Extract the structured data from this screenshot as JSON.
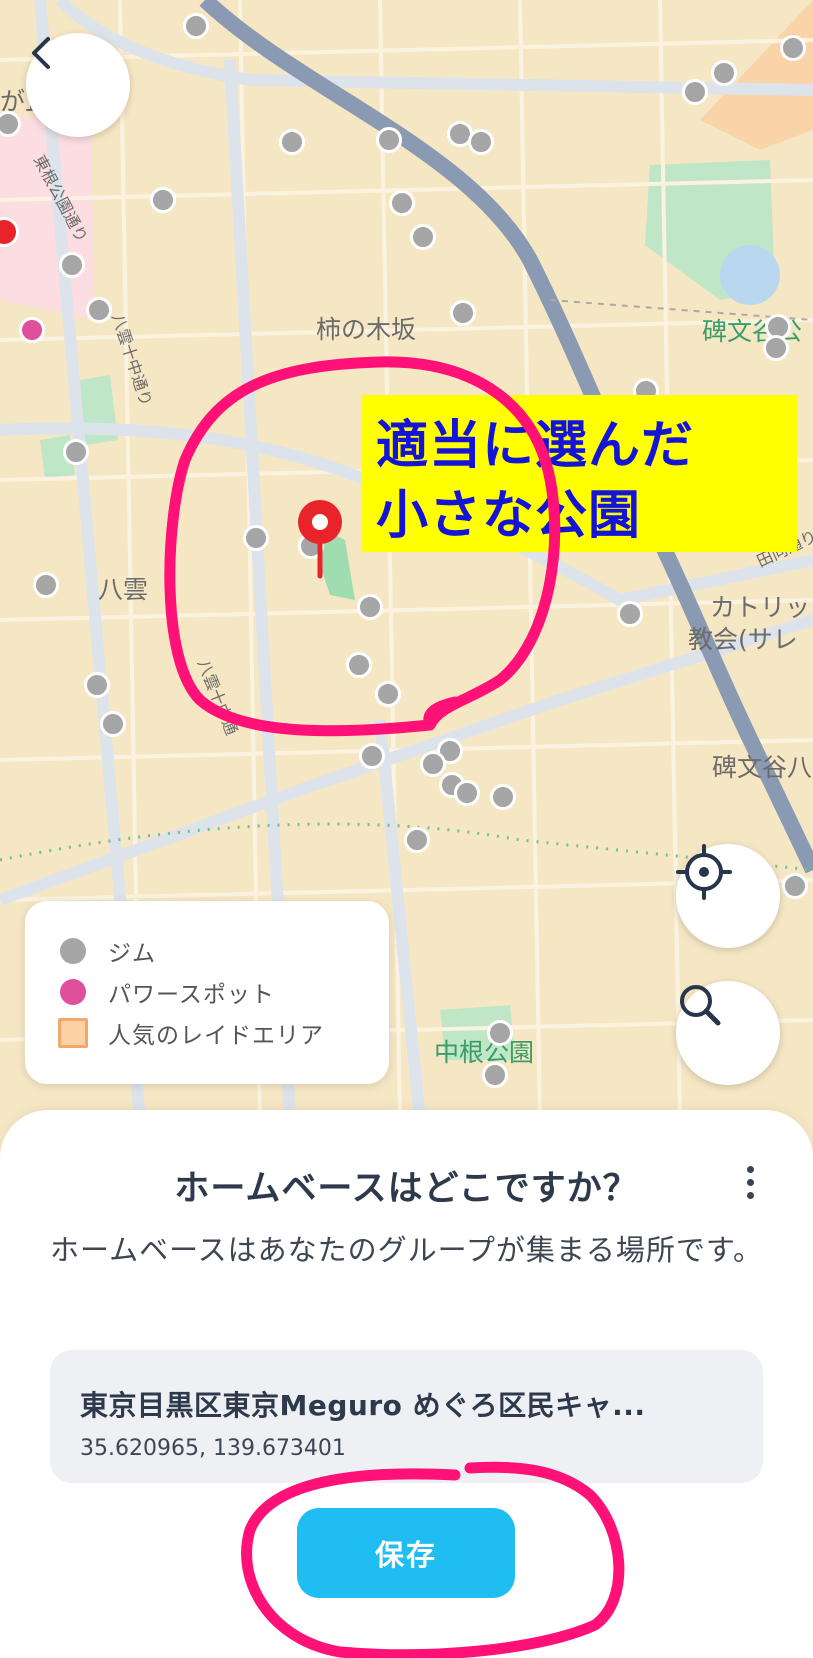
{
  "map": {
    "labels": {
      "kakinokizaka": "柿の木坂",
      "yakumo": "八雲",
      "himonya_park": "碑文谷公",
      "catholic": "カトリッ",
      "catholic2": "教会(サレ",
      "himonya8": "碑文谷八",
      "nakane_park": "中根公園",
      "tokone_street": "東根公園通り",
      "yakumo_street": "八雲十中通り",
      "yakumo_street2": "八雲十中通",
      "hinata_street": "田向通り",
      "top_left_partial": "が丘"
    },
    "colors": {
      "gym": "#a6a6a6",
      "power_spot": "#e04f9c",
      "raid_area": "#f5a76a",
      "pin": "#e8242a"
    }
  },
  "callout": {
    "line1": "適当に選んだ",
    "line2": "小さな公園"
  },
  "legend": {
    "items": [
      {
        "label": "ジム",
        "icon": "gray-circle"
      },
      {
        "label": "パワースポット",
        "icon": "pink-circle"
      },
      {
        "label": "人気のレイドエリア",
        "icon": "orange-square"
      }
    ]
  },
  "controls": {
    "back_icon": "chevron-left-icon",
    "locate_icon": "crosshair-icon",
    "search_icon": "search-icon"
  },
  "sheet": {
    "title": "ホームベースはどこですか？",
    "description": "ホームベースはあなたのグループが集まる場所です。",
    "location_name": "東京目黒区東京Meguro めぐろ区民キャ...",
    "coordinates": "35.620965, 139.673401",
    "save_label": "保存"
  }
}
